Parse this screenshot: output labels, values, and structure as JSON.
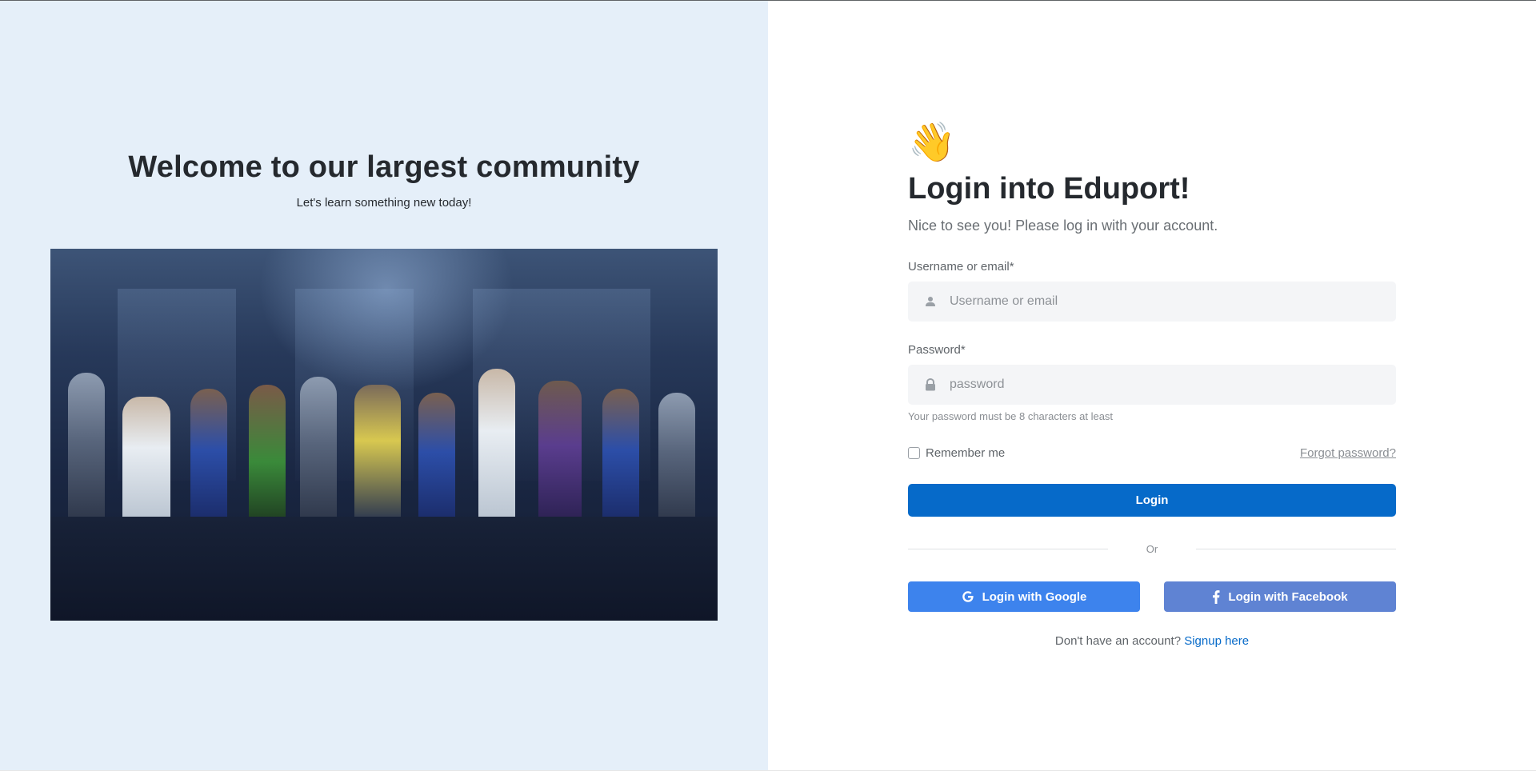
{
  "left": {
    "title": "Welcome to our largest community",
    "subtitle": "Let's learn something new today!"
  },
  "form": {
    "wave_emoji": "👋",
    "title": "Login into Eduport!",
    "lead": "Nice to see you! Please log in with your account.",
    "username": {
      "label": "Username or email*",
      "placeholder": "Username or email",
      "value": "",
      "icon": "person-icon"
    },
    "password": {
      "label": "Password*",
      "placeholder": "password",
      "value": "",
      "icon": "lock-icon",
      "hint": "Your password must be 8 characters at least"
    },
    "remember_label": "Remember me",
    "remember_checked": false,
    "forgot_label": "Forgot password?",
    "login_label": "Login",
    "divider_label": "Or",
    "google_label": "Login with Google",
    "facebook_label": "Login with Facebook",
    "signup_prompt": "Don't have an account?",
    "signup_link": "Signup here"
  },
  "colors": {
    "left_bg": "#e5eff9",
    "primary": "#066ac9",
    "google": "#3d83ed",
    "facebook": "#5f83d3",
    "input_bg": "#f4f5f7"
  }
}
